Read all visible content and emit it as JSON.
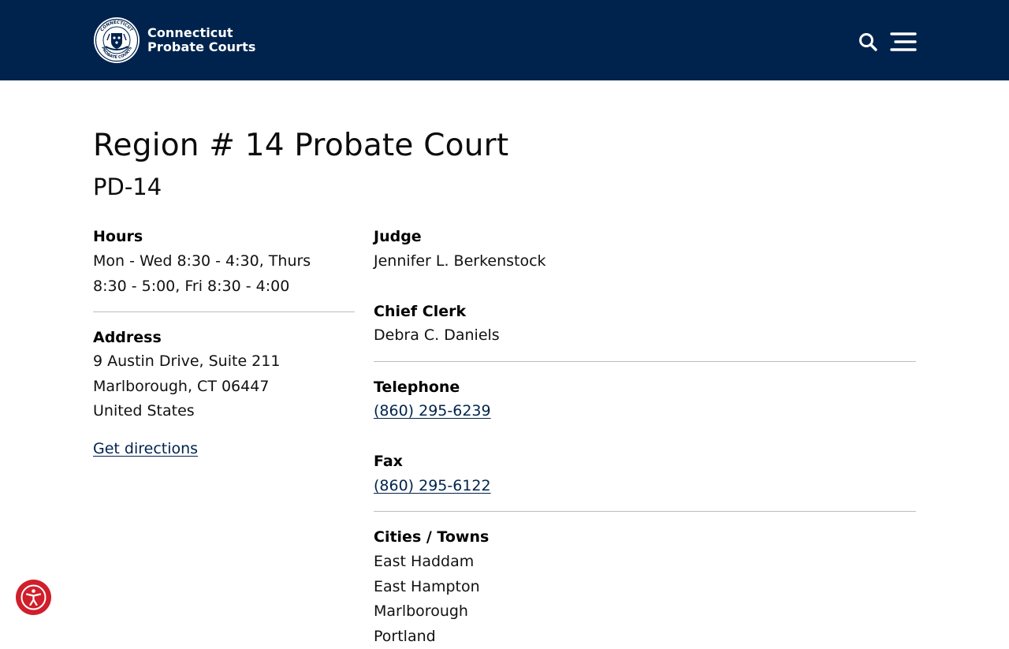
{
  "header": {
    "brand_line1": "Connecticut",
    "brand_line2": "Probate Courts",
    "seal_text_top": "CONNECTICUT",
    "seal_text_bottom": "PROBATE COURTS",
    "search_icon": "search-icon",
    "menu_icon": "hamburger-menu-icon",
    "background_color": "#00234d"
  },
  "page": {
    "title": "Region # 14 Probate Court",
    "subtitle": "PD-14"
  },
  "hours": {
    "label": "Hours",
    "lines": [
      "Mon - Wed 8:30 - 4:30, Thurs",
      "8:30 - 5:00, Fri 8:30 - 4:00"
    ]
  },
  "address": {
    "label": "Address",
    "lines": [
      "9 Austin Drive, Suite 211",
      "Marlborough, CT 06447",
      "United States"
    ],
    "directions_link": "Get directions"
  },
  "judge": {
    "label": "Judge",
    "value": "Jennifer L. Berkenstock"
  },
  "chief_clerk": {
    "label": "Chief Clerk",
    "value": "Debra C. Daniels"
  },
  "telephone": {
    "label": "Telephone",
    "value": "(860) 295-6239"
  },
  "fax": {
    "label": "Fax",
    "value": "(860) 295-6122"
  },
  "towns": {
    "label": "Cities / Towns",
    "items": [
      "East Haddam",
      "East Hampton",
      "Marlborough",
      "Portland"
    ]
  },
  "accessibility": {
    "icon": "accessibility-icon",
    "color": "#d01f2b"
  },
  "colors": {
    "link": "#00234d",
    "divider": "#bdbdbd"
  }
}
